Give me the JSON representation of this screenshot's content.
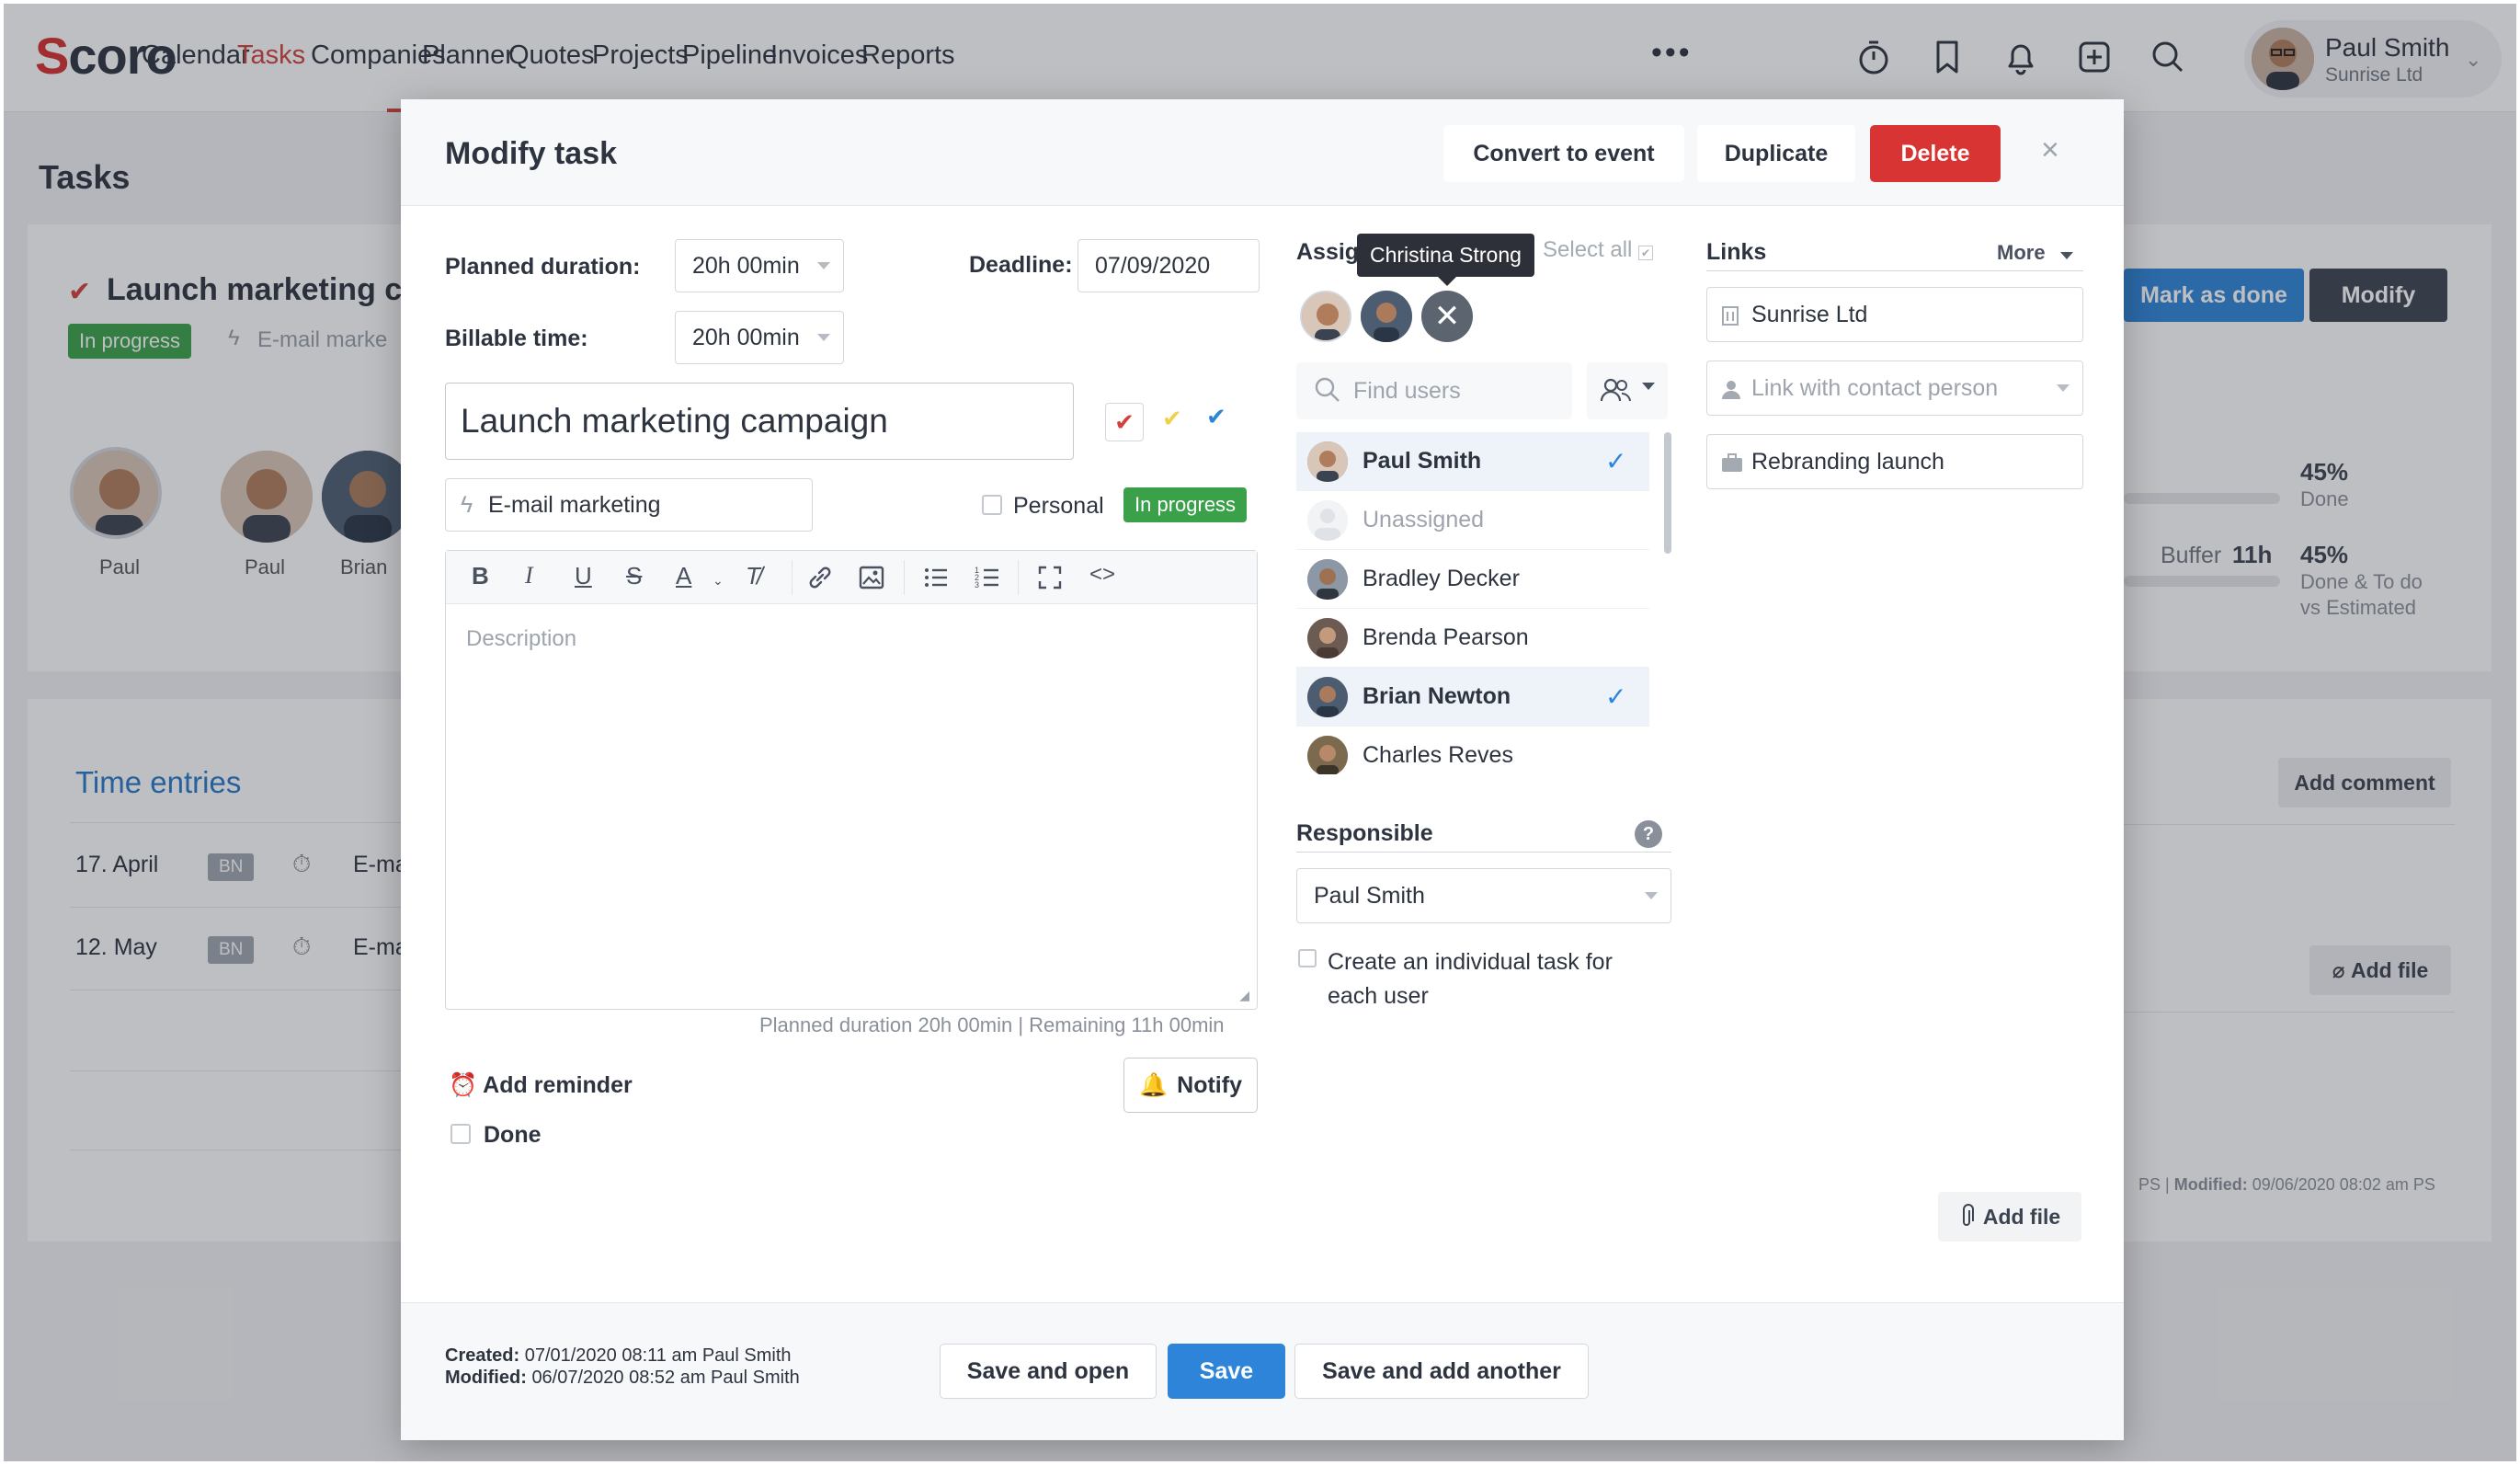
{
  "brand": {
    "logo": "Scoro",
    "accent": "#d2413c",
    "primary": "#2d84d8"
  },
  "nav": {
    "items": [
      "Calendar",
      "Tasks",
      "Companies",
      "Planner",
      "Quotes",
      "Projects",
      "Pipeline",
      "Invoices",
      "Reports"
    ],
    "active": "Tasks",
    "more": "•••",
    "icons": [
      "stopwatch-icon",
      "bookmark-icon",
      "bell-icon",
      "add-square-icon",
      "search-icon"
    ]
  },
  "user": {
    "name": "Paul Smith",
    "company": "Sunrise Ltd"
  },
  "background": {
    "page_title": "Tasks",
    "task_title": "Launch marketing ca",
    "status": "In progress",
    "project": "E-mail marke",
    "avatars": [
      "Paul",
      "Paul",
      "Brian"
    ],
    "mark_done": "Mark as done",
    "modify": "Modify",
    "done_pct": "45%",
    "done_label": "Done",
    "buffer": "Buffer",
    "buffer_value": "11h",
    "est_pct": "45%",
    "est_label_1": "Done & To do",
    "est_label_2": "vs Estimated",
    "time_entries_title": "Time entries",
    "time_entries": [
      {
        "date": "17. April",
        "initials": "BN",
        "desc": "E-ma"
      },
      {
        "date": "12. May",
        "initials": "BN",
        "desc": "E-ma"
      }
    ],
    "add_comment": "Add comment",
    "add_file": "Add file",
    "modified_prefix": "PS |",
    "modified_label": "Modified:",
    "modified_value": "09/06/2020 08:02 am PS"
  },
  "modal": {
    "title": "Modify task",
    "buttons": {
      "convert": "Convert to event",
      "duplicate": "Duplicate",
      "delete": "Delete",
      "close": "×"
    },
    "planned_duration_label": "Planned duration:",
    "planned_duration_value": "20h 00min",
    "billable_time_label": "Billable time:",
    "billable_time_value": "20h 00min",
    "deadline_label": "Deadline:",
    "deadline_value": "07/09/2020",
    "task_name": "Launch marketing campaign",
    "project": "E-mail marketing",
    "personal_label": "Personal",
    "status": "In progress",
    "description_placeholder": "Description",
    "duration_note": "Planned duration 20h 00min | Remaining 11h 00min",
    "add_reminder": "Add reminder",
    "notify": "Notify",
    "done_label": "Done",
    "assignees_label": "Assignees",
    "select_all": "Select all",
    "tooltip": "Christina Strong",
    "find_users_placeholder": "Find users",
    "users": [
      {
        "name": "Paul Smith",
        "selected": true
      },
      {
        "name": "Unassigned",
        "selected": false
      },
      {
        "name": "Bradley Decker",
        "selected": false
      },
      {
        "name": "Brenda Pearson",
        "selected": false
      },
      {
        "name": "Brian Newton",
        "selected": true
      },
      {
        "name": "Charles Reves",
        "selected": false
      }
    ],
    "responsible_label": "Responsible",
    "responsible_help": "?",
    "responsible_value": "Paul Smith",
    "individual_task_label": "Create an individual task for each user",
    "links_label": "Links",
    "links_more": "More",
    "link_company": "Sunrise Ltd",
    "link_contact_placeholder": "Link with contact person",
    "link_project": "Rebranding launch",
    "add_file": "Add file",
    "footer": {
      "created_label": "Created:",
      "created_value": "07/01/2020 08:11 am Paul Smith",
      "modified_label": "Modified:",
      "modified_value": "06/07/2020 08:52 am Paul Smith",
      "save_open": "Save and open",
      "save": "Save",
      "save_add": "Save and add another"
    }
  }
}
